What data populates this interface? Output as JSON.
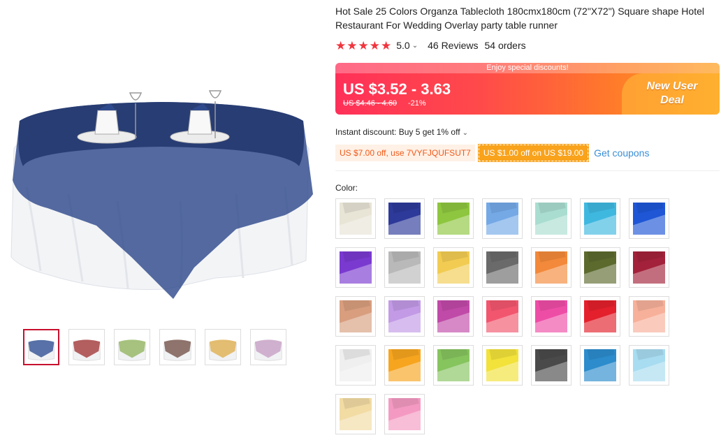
{
  "product": {
    "title": "Hot Sale 25 Colors Organza Tablecloth 180cmx180cm (72\"X72\") Square shape Hotel Restaurant For Wedding Overlay party table runner",
    "rating": "5.0",
    "stars": 5,
    "reviews": "46 Reviews",
    "orders": "54 orders"
  },
  "price": {
    "promo_strip": "Enjoy special discounts!",
    "current": "US $3.52 - 3.63",
    "original": "US $4.46 - 4.60",
    "discount": "-21%",
    "deal_label": "New User Deal"
  },
  "discounts": {
    "instant": "Instant discount: Buy 5 get 1% off",
    "coupon_a": "US $7.00 off, use 7VYFJQUFSUT7",
    "coupon_b": "US $1.00 off on US $19.00",
    "get_coupons": "Get coupons"
  },
  "color_label": "Color:",
  "images": {
    "main_tablecloth_color": "#2f4a8c",
    "thumbnails": [
      {
        "color": "#3d5a9a",
        "active": true
      },
      {
        "color": "#a84545",
        "active": false
      },
      {
        "color": "#9aba6a",
        "active": false
      },
      {
        "color": "#7d5e55",
        "active": false
      },
      {
        "color": "#e0b45a",
        "active": false
      },
      {
        "color": "#c9a6c8",
        "active": false
      }
    ]
  },
  "swatches": [
    {
      "color": "#e8e4d6"
    },
    {
      "color": "#2d3a9a"
    },
    {
      "color": "#8ec63f"
    },
    {
      "color": "#74a9e6"
    },
    {
      "color": "#a9ddcf"
    },
    {
      "color": "#3fb8e0"
    },
    {
      "color": "#1e56d6"
    },
    {
      "color": "#7a3ad0"
    },
    {
      "color": "#b9b9b9"
    },
    {
      "color": "#f2cc52"
    },
    {
      "color": "#6a6a6a"
    },
    {
      "color": "#f3893a"
    },
    {
      "color": "#5c6a2e"
    },
    {
      "color": "#a3213a"
    },
    {
      "color": "#d89e7e"
    },
    {
      "color": "#c29ae6"
    },
    {
      "color": "#c04aa8"
    },
    {
      "color": "#f2566e"
    },
    {
      "color": "#ee4da6"
    },
    {
      "color": "#e3202c"
    },
    {
      "color": "#f7b09a"
    },
    {
      "color": "#efefef"
    },
    {
      "color": "#f7a51f"
    },
    {
      "color": "#86c45e"
    },
    {
      "color": "#f2e23a"
    },
    {
      "color": "#4a4a4a"
    },
    {
      "color": "#2c8ccc"
    },
    {
      "color": "#a8dcf0"
    },
    {
      "color": "#f2dca4"
    },
    {
      "color": "#f49ac2"
    }
  ]
}
